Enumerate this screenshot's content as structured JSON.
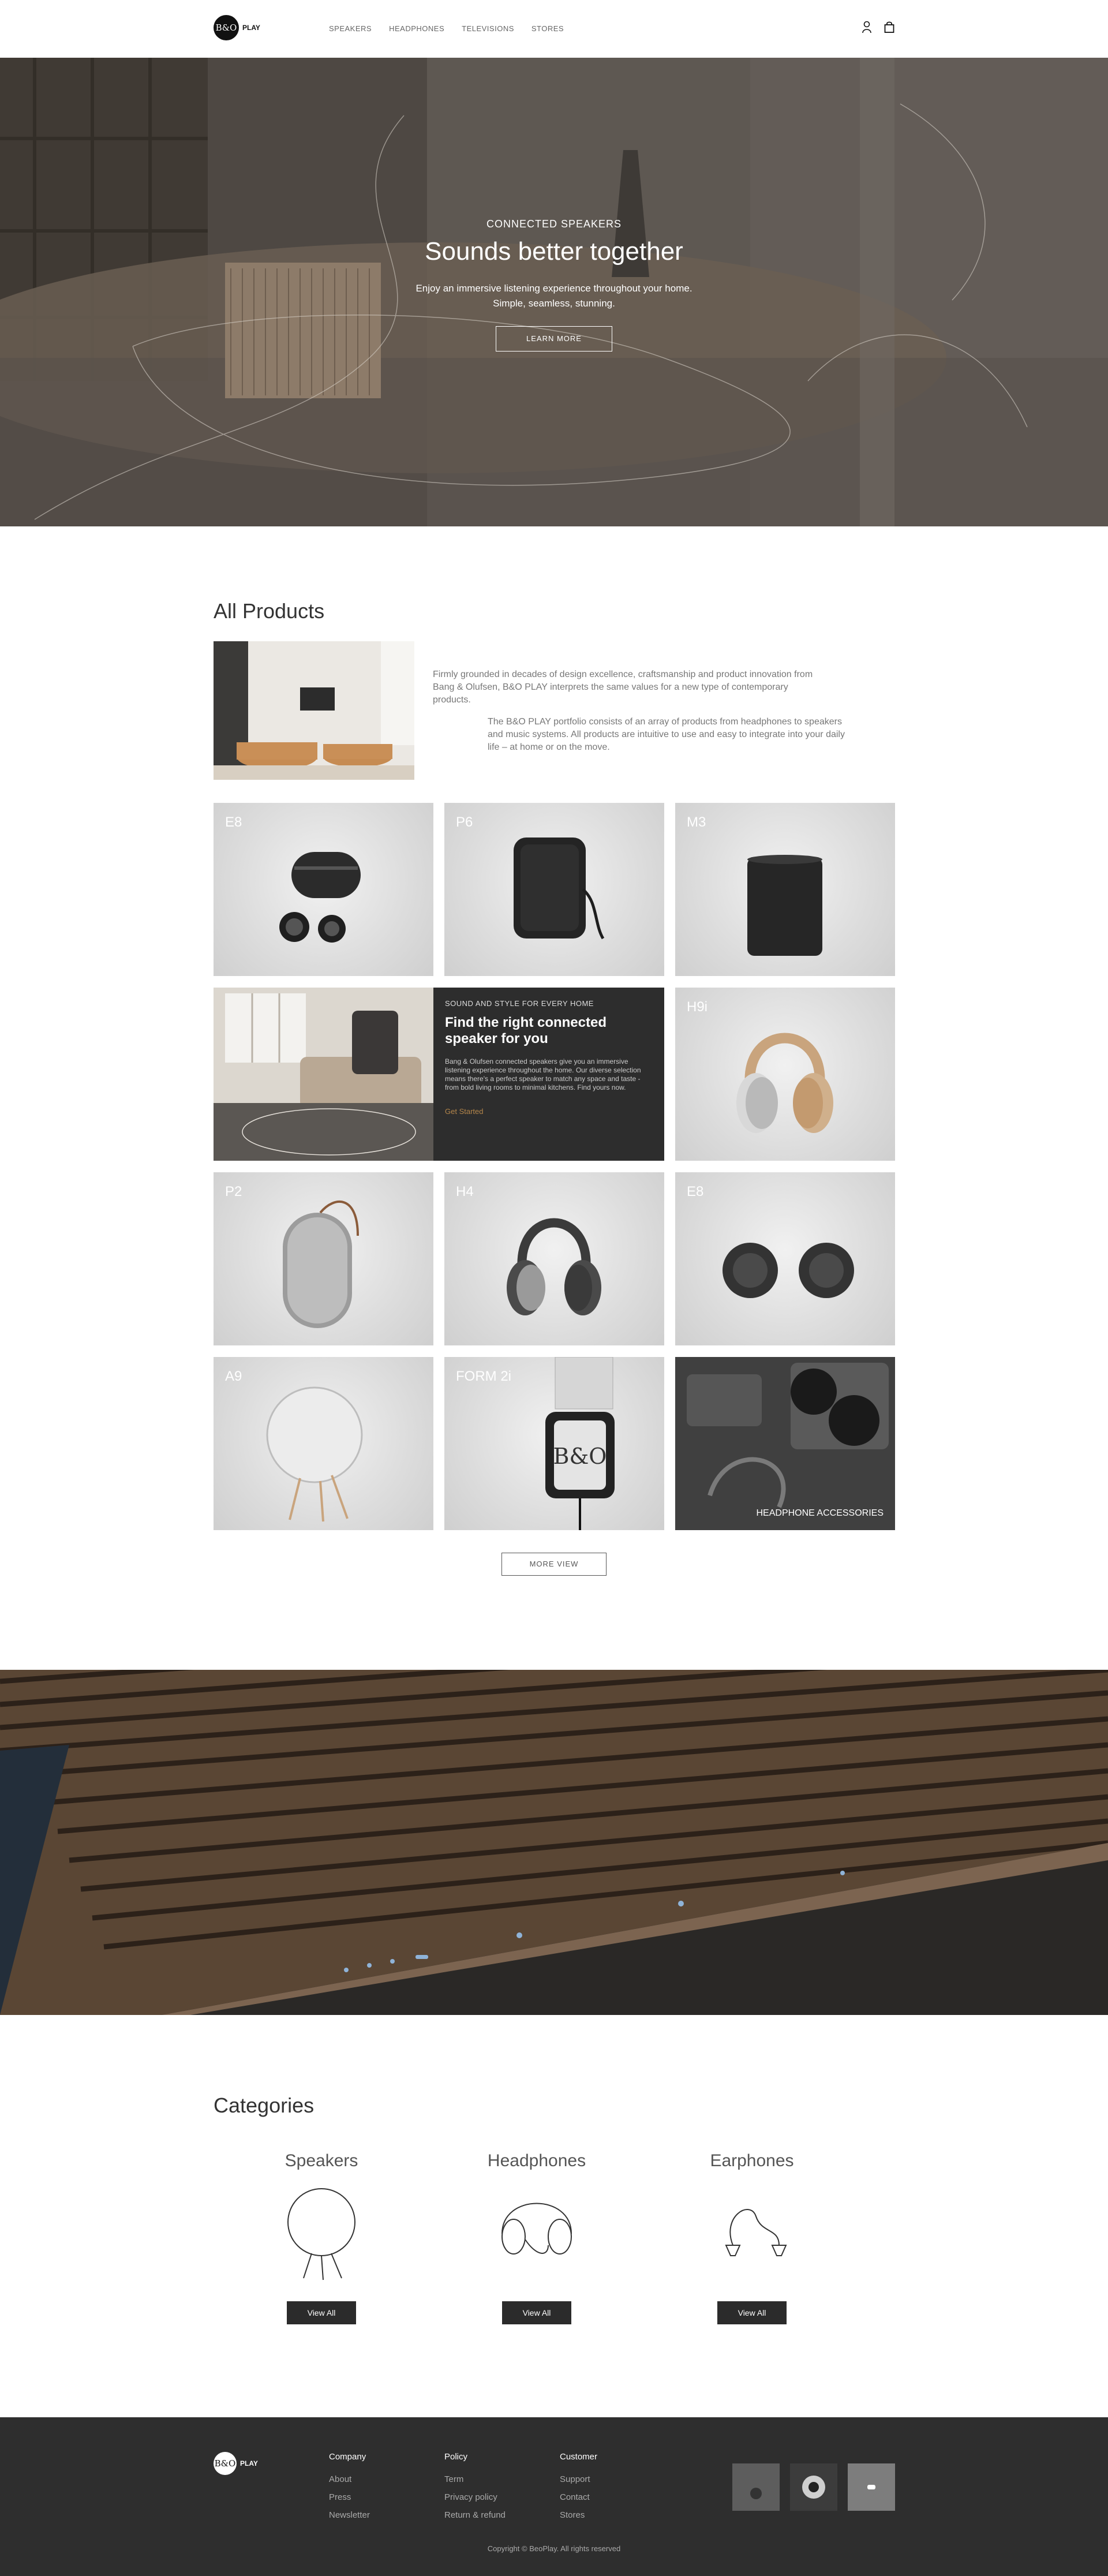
{
  "header": {
    "logo_monogram": "B&O",
    "logo_text": "PLAY",
    "nav": [
      "SPEAKERS",
      "HEADPHONES",
      "TELEVISIONS",
      "STORES"
    ],
    "icons": [
      "user-icon",
      "shopping-bag-icon"
    ]
  },
  "hero": {
    "kicker": "CONNECTED SPEAKERS",
    "title": "Sounds better together",
    "desc_line1": "Enjoy an immersive listening experience throughout your home.",
    "desc_line2": "Simple, seamless, stunning.",
    "button": "LEARN MORE"
  },
  "products": {
    "title": "All Products",
    "intro1": "Firmly grounded in decades of design excellence, craftsmanship and product innovation from Bang & Olufsen, B&O PLAY interprets the same values for a new type of contemporary products.",
    "intro2": "The B&O PLAY portfolio consists of an array of products from headphones to speakers and music systems. All products are intuitive to use and easy to integrate into your daily life – at home or on the move.",
    "tiles": [
      "E8",
      "P6",
      "M3",
      "H9i",
      "P2",
      "H4",
      "E8",
      "A9",
      "FORM 2i"
    ],
    "accessories_label": "HEADPHONE ACCESSORIES",
    "feature": {
      "kicker": "SOUND AND STYLE FOR EVERY HOME",
      "title": "Find the right connected speaker for you",
      "body": "Bang & Olufsen connected speakers give you an immersive listening experience throughout the home. Our diverse selection means there's a perfect speaker to match any space and taste - from bold living rooms to minimal kitchens. Find yours now.",
      "link": "Get Started"
    },
    "more_button": "MORE VIEW"
  },
  "categories": {
    "title": "Categories",
    "items": [
      {
        "title": "Speakers",
        "button": "View All"
      },
      {
        "title": "Headphones",
        "button": "View All"
      },
      {
        "title": "Earphones",
        "button": "View All"
      }
    ]
  },
  "footer": {
    "logo_monogram": "B&O",
    "logo_text": "PLAY",
    "columns": [
      {
        "head": "Company",
        "items": [
          "About",
          "Press",
          "Newsletter"
        ]
      },
      {
        "head": "Policy",
        "items": [
          "Term",
          "Privacy policy",
          "Return & refund"
        ]
      },
      {
        "head": "Customer",
        "items": [
          "Support",
          "Contact",
          "Stores"
        ]
      }
    ],
    "copyright": "Copyright © BeoPlay. All rights reserved"
  }
}
